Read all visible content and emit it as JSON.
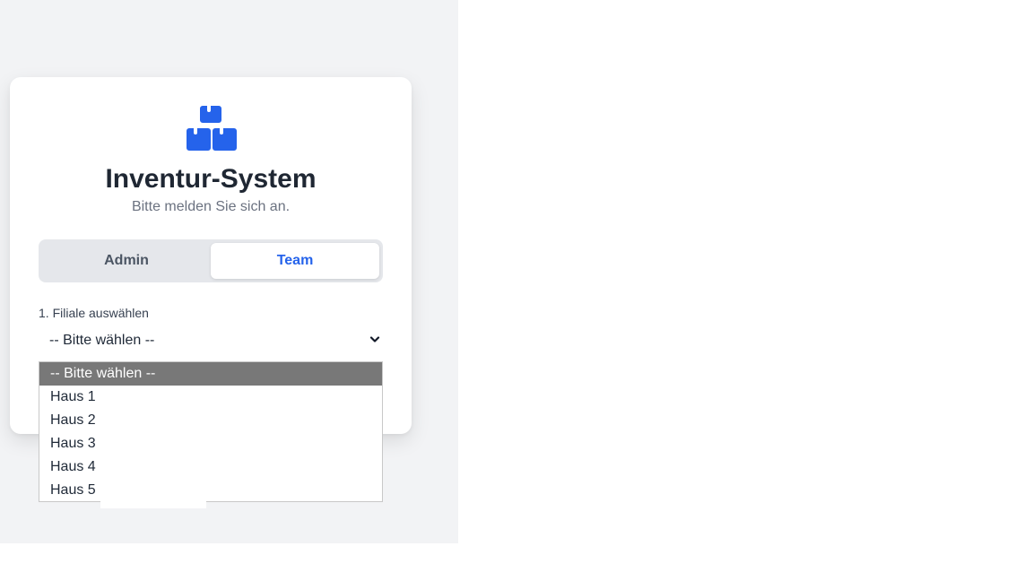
{
  "app": {
    "title": "Inventur-System",
    "subtitle": "Bitte melden Sie sich an."
  },
  "logo": {
    "icon": "boxes-icon",
    "color": "#2563eb"
  },
  "tabs": [
    {
      "label": "Admin",
      "active": false
    },
    {
      "label": "Team",
      "active": true
    }
  ],
  "branch_select": {
    "label": "1. Filiale auswählen",
    "value": "-- Bitte wählen --",
    "options": [
      {
        "label": "-- Bitte wählen --",
        "selected": true
      },
      {
        "label": "Haus 1",
        "selected": false
      },
      {
        "label": "Haus 2",
        "selected": false
      },
      {
        "label": "Haus 3",
        "selected": false
      },
      {
        "label": "Haus 4",
        "selected": false
      },
      {
        "label": "Haus 5",
        "selected": false
      }
    ]
  },
  "colors": {
    "accent": "#2563eb",
    "page_background": "#f2f3f5",
    "option_highlight": "#787878"
  }
}
